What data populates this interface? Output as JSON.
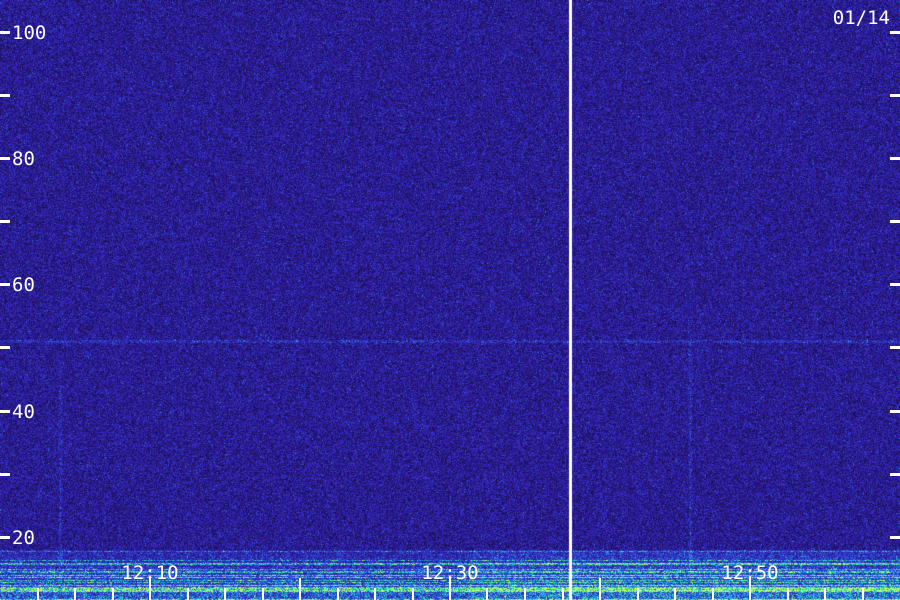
{
  "date_label": "01/14",
  "chart_data": {
    "type": "heatmap",
    "title": "",
    "xlabel": "",
    "ylabel": "",
    "y_axis": {
      "range": [
        10,
        105
      ],
      "ticks": [
        20,
        30,
        40,
        50,
        60,
        70,
        80,
        90,
        100
      ],
      "tick_labels": [
        "20",
        "40",
        "60",
        "80",
        "100"
      ]
    },
    "x_axis": {
      "range_minutes": [
        0,
        60
      ],
      "labels": [
        {
          "text": "12:10",
          "minute": 10
        },
        {
          "text": "12:30",
          "minute": 30
        },
        {
          "text": "12:50",
          "minute": 50
        }
      ]
    },
    "gap_marker_minute": 38,
    "colors": {
      "background": "#1b1050",
      "low": "#2a1a9a",
      "mid": "#2b7be0",
      "high": "#34e8a0",
      "peak": "#b8ff60",
      "axis": "#ffffff"
    },
    "features": [
      {
        "kind": "horizontal-line",
        "y": 51,
        "from_minute": 0,
        "to_minute": 60
      },
      {
        "kind": "vertical-streak",
        "minute": 4,
        "y_range": [
          16,
          48
        ]
      },
      {
        "kind": "vertical-streak",
        "minute": 46,
        "y_range": [
          14,
          52
        ]
      },
      {
        "kind": "low-band",
        "y_range": [
          10,
          18
        ],
        "intensity": "high"
      }
    ]
  }
}
